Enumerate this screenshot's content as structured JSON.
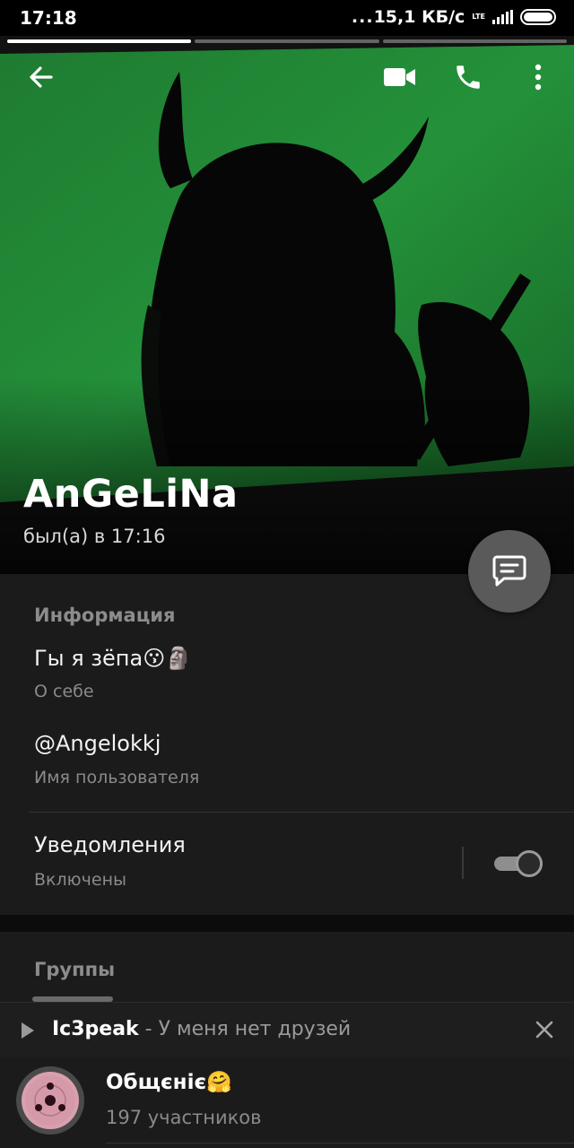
{
  "status_bar": {
    "time": "17:18",
    "net_speed": "15,1 КБ/с",
    "network_type": "LTE",
    "story_segments": 3,
    "active_segment": 1
  },
  "header": {
    "back_icon": "arrow-left-icon",
    "video_icon": "video-camera-icon",
    "call_icon": "phone-icon",
    "menu_icon": "more-vertical-icon",
    "profile_name": "AnGeLiNa",
    "last_seen": "был(а) в 17:16",
    "photo_accent": "#1f8a33"
  },
  "fab": {
    "icon": "message-icon"
  },
  "info": {
    "title": "Информация",
    "bio_value": "Гы я зёпа😗🗿",
    "bio_caption": "О себе",
    "username_value": "@Angelokkj",
    "username_caption": "Имя пользователя",
    "notifications_label": "Уведомления",
    "notifications_caption": "Включены",
    "notifications_enabled": true
  },
  "groups": {
    "title": "Группы",
    "items": [
      {
        "name": "Общєнiє🤗",
        "members": "197 участников"
      }
    ]
  },
  "music_player": {
    "artist": "Ic3peak",
    "separator": " - ",
    "track": "У меня нет друзей"
  }
}
